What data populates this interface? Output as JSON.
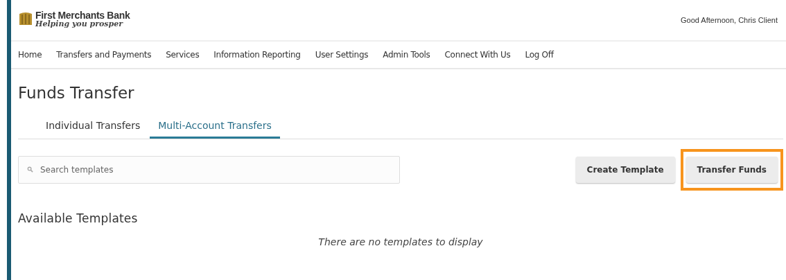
{
  "header": {
    "bank_name": "First Merchants Bank",
    "tagline": "Helping you prosper",
    "greeting": "Good Afternoon, Chris Client"
  },
  "nav": [
    "Home",
    "Transfers and Payments",
    "Services",
    "Information Reporting",
    "User Settings",
    "Admin Tools",
    "Connect With Us",
    "Log Off"
  ],
  "page_title": "Funds Transfer",
  "tabs": [
    {
      "label": "Individual Transfers",
      "selected": false
    },
    {
      "label": "Multi-Account Transfers",
      "selected": true
    }
  ],
  "search": {
    "placeholder": "Search templates"
  },
  "buttons": [
    {
      "label": "Create Template",
      "highlighted": false
    },
    {
      "label": "Transfer Funds",
      "highlighted": true
    }
  ],
  "section_title": "Available Templates",
  "empty_message": "There are no templates to display"
}
